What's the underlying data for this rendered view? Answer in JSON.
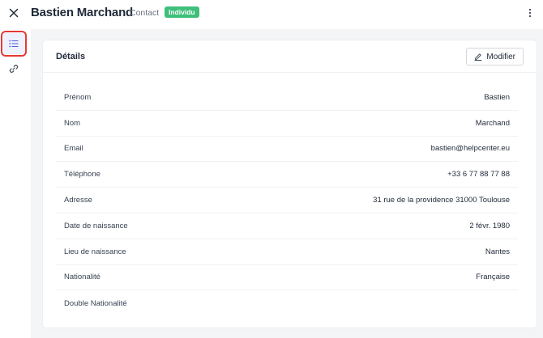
{
  "header": {
    "title": "Bastien Marchand",
    "subtitle": "Contact",
    "badge": "Individu",
    "badge_color": "#3fc07a",
    "close_icon": "close-icon",
    "more_icon": "more-vertical-icon"
  },
  "sidebar": {
    "items": [
      {
        "name": "details",
        "icon": "list-icon",
        "active": true
      },
      {
        "name": "links",
        "icon": "link-icon",
        "active": false
      }
    ]
  },
  "card": {
    "title": "Détails",
    "edit_label": "Modifier",
    "edit_icon": "pencil-icon",
    "rows": [
      {
        "label": "Prénom",
        "value": "Bastien"
      },
      {
        "label": "Nom",
        "value": "Marchand"
      },
      {
        "label": "Email",
        "value": "bastien@helpcenter.eu"
      },
      {
        "label": "Téléphone",
        "value": "+33 6 77 88 77 88"
      },
      {
        "label": "Adresse",
        "value": "31 rue de la providence 31000 Toulouse"
      },
      {
        "label": "Date de naissance",
        "value": "2 févr. 1980"
      },
      {
        "label": "Lieu de naissance",
        "value": "Nantes"
      },
      {
        "label": "Nationalité",
        "value": "Française"
      },
      {
        "label": "Double Nationalité",
        "value": ""
      }
    ]
  }
}
